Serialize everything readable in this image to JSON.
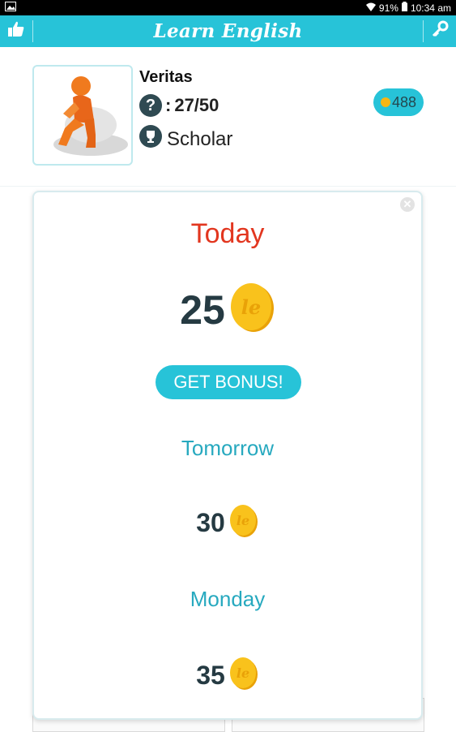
{
  "status_bar": {
    "battery": "91%",
    "time": "10:34 am"
  },
  "header": {
    "title": "Learn English"
  },
  "profile": {
    "name": "Veritas",
    "progress_sep": ":",
    "progress": "27/50",
    "rank": "Scholar",
    "coins": "488"
  },
  "bonus_popup": {
    "today_label": "Today",
    "today_amount": "25",
    "get_bonus_label": "GET BONUS!",
    "tomorrow_label": "Tomorrow",
    "tomorrow_amount": "30",
    "next_day_label": "Monday",
    "next_day_amount": "35"
  },
  "colors": {
    "accent": "#27c3d8",
    "today": "#e2361f",
    "coin": "#f6b614",
    "text_dark": "#253a42"
  },
  "icons": [
    "image-icon",
    "wifi-icon",
    "battery-icon",
    "thumbs-up-icon",
    "key-icon",
    "question-icon",
    "trophy-icon",
    "coin-icon",
    "close-icon"
  ]
}
